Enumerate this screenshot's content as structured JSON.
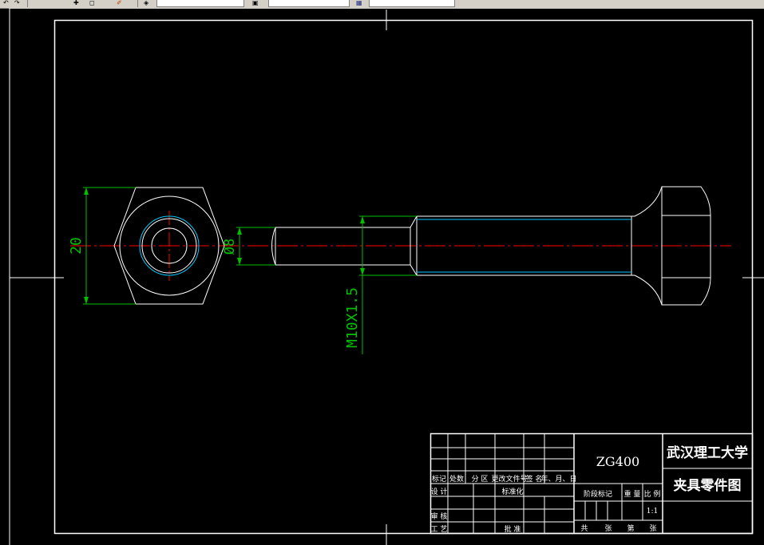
{
  "toolbar": {
    "buttons": [
      "undo-icon",
      "redo-icon",
      "pan-icon",
      "match-properties-icon",
      "layer-icon",
      "color-icon"
    ],
    "layer_value": "",
    "color_value": ""
  },
  "drawing": {
    "dimensions": {
      "hex_width": "20",
      "rod_diameter": "Ø8",
      "thread": "M10X1.5"
    },
    "title_block": {
      "part_number": "ZG400",
      "school": "武汉理工大学",
      "drawing_name": "夹具零件图",
      "revision_headers": [
        "标记",
        "处数",
        "分 区",
        "更改文件号",
        "签 名",
        "年、月、日"
      ],
      "design_label": "设 计",
      "standardization_label": "标准化",
      "review_label": "审 核",
      "process_label": "工 艺",
      "approve_label": "批 准",
      "stage_label": "阶段标记",
      "weight_label": "重 量",
      "scale_label": "比 例",
      "scale_value": "1:1",
      "sheet_total_label": "共",
      "sheet_label": "张",
      "sheet_no_label": "第",
      "sheet_label_2": "张"
    }
  },
  "colors": {
    "background": "#000000",
    "geometry": "#ffffff",
    "dimension": "#00c000",
    "centerline": "#ff0000",
    "thread_inner": "#00c8ff"
  }
}
